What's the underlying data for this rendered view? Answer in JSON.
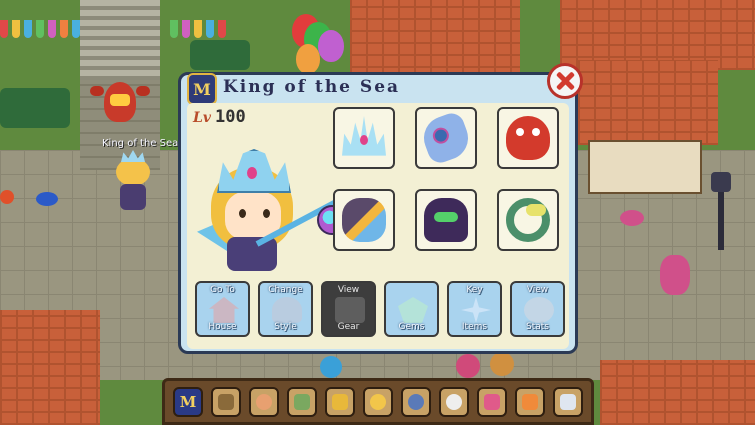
{
  "world": {
    "nametag": "King of the Sea",
    "balloon_colors": [
      "#e23c3c",
      "#3cb44a",
      "#f0a040",
      "#c060d0"
    ]
  },
  "dialog": {
    "badge": "M",
    "title": "King of the Sea",
    "level_label": "Lv",
    "level": "100",
    "close_icon": "close-x-icon"
  },
  "gear_slots": [
    {
      "name": "crown",
      "icon": "ice-crown-icon"
    },
    {
      "name": "outfit",
      "icon": "fish-outfit-icon"
    },
    {
      "name": "pet",
      "icon": "red-pet-icon"
    },
    {
      "name": "weapon",
      "icon": "fish-wand-icon"
    },
    {
      "name": "boots",
      "icon": "purple-boots-icon"
    },
    {
      "name": "relic",
      "icon": "jade-ring-icon"
    }
  ],
  "actions": [
    {
      "top": "Go To",
      "bottom": "House",
      "icon": "house-icon",
      "active": false
    },
    {
      "top": "Change",
      "bottom": "Style",
      "icon": "style-icon",
      "active": false
    },
    {
      "top": "View",
      "bottom": "Gear",
      "icon": "gear-icon",
      "active": true
    },
    {
      "top": "",
      "bottom": "Gems",
      "icon": "gem-icon",
      "active": false
    },
    {
      "top": "Key",
      "bottom": "Items",
      "icon": "key-item-icon",
      "active": false
    },
    {
      "top": "View",
      "bottom": "Stats",
      "icon": "stats-icon",
      "active": false
    }
  ],
  "toolbar": {
    "badge": "M",
    "buttons": [
      "member-icon",
      "backpack-icon",
      "paw-icon",
      "map-icon",
      "trophy-icon",
      "sun-icon",
      "settings-icon",
      "chat-icon",
      "friends-icon",
      "events-icon",
      "mail-icon"
    ]
  },
  "colors": {
    "dialog_bg": "#c9e3f0",
    "panel_bg": "#f3f0d4",
    "active_button": "#3d3d3d",
    "close_red": "#d23a2f"
  }
}
